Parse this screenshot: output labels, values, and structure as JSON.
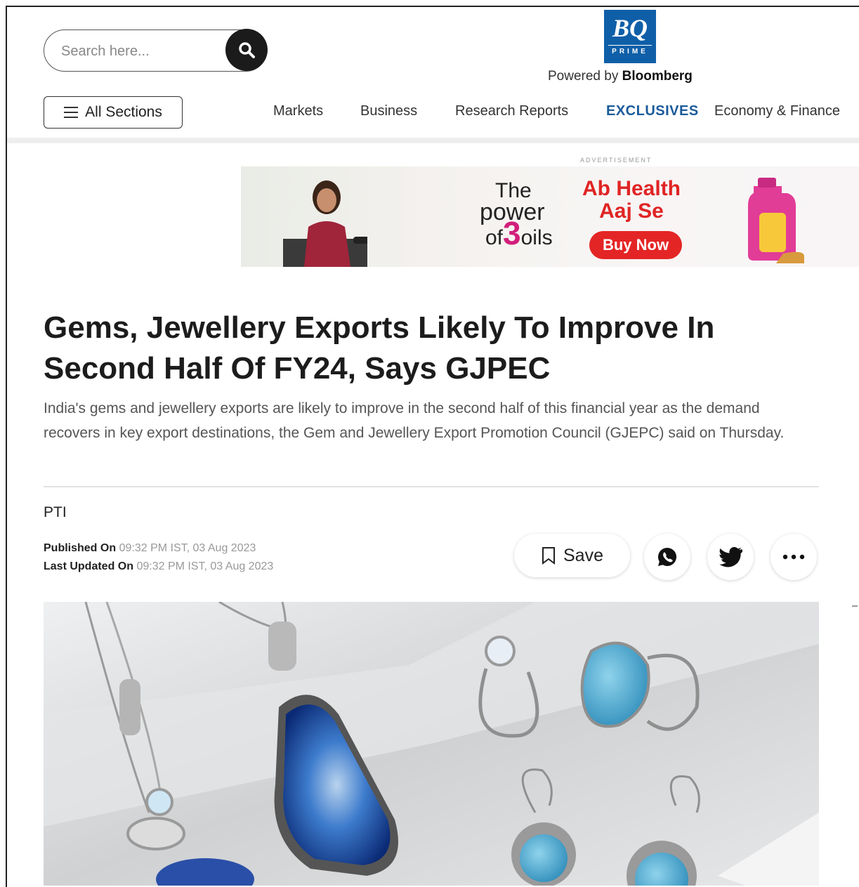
{
  "header": {
    "search": {
      "placeholder": "Search here..."
    },
    "logo": {
      "main": "BQ",
      "sub": "PRIME"
    },
    "powered_prefix": "Powered by",
    "powered_brand": "Bloomberg",
    "all_sections_label": "All Sections",
    "nav": [
      "Markets",
      "Business",
      "Research Reports",
      "EXCLUSIVES",
      "Economy & Finance"
    ]
  },
  "ad": {
    "label": "ADVERTISEMENT",
    "line1": "The",
    "line2": "power",
    "line3_prefix": "of",
    "line3_number": "3",
    "line3_suffix": "oils",
    "tagline1": "Ab Health",
    "tagline2": "Aaj Se",
    "cta": "Buy Now",
    "colors": {
      "accent": "#e42525",
      "pink": "#d11f7a"
    }
  },
  "article": {
    "title": "Gems, Jewellery Exports Likely To Improve In Second Half Of FY24, Says GJPEC",
    "lede": "India's gems and jewellery exports are likely to improve in the second half of this financial year as the demand recovers in key export destinations, the Gem and Jewellery Export Promotion Council (GJEPC) said on Thursday.",
    "author": "PTI",
    "published_label": "Published On",
    "published_value": "09:32 PM IST, 03 Aug 2023",
    "updated_label": "Last Updated On",
    "updated_value": "09:32 PM IST, 03 Aug 2023",
    "save_label": "Save"
  },
  "icons": [
    "search-icon",
    "hamburger-icon",
    "bookmark-icon",
    "whatsapp-icon",
    "twitter-icon",
    "more-icon"
  ]
}
